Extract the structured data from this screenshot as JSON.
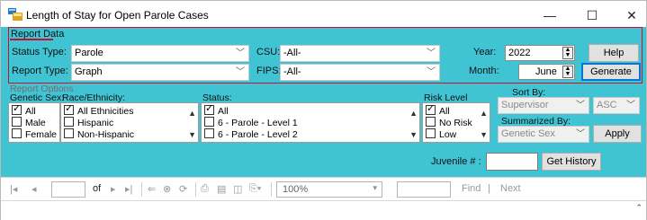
{
  "window": {
    "title": "Length of Stay for Open Parole Cases",
    "min_glyph": "—",
    "max_glyph": "☐",
    "close_glyph": "✕"
  },
  "report_data": {
    "group_label": "Report Data",
    "status_type_label": "Status Type:",
    "status_type_value": "Parole",
    "report_type_label": "Report Type:",
    "report_type_value": "Graph",
    "csu_label": "CSU:",
    "csu_value": "-All-",
    "fips_label": "FIPS:",
    "fips_value": "-All-",
    "year_label": "Year:",
    "year_value": "2022",
    "month_label": "Month:",
    "month_value": "June",
    "help_label": "Help",
    "generate_label": "Generate"
  },
  "report_options": {
    "group_label": "Report Options",
    "genetic_sex_label": "Genetic Sex:",
    "genetic_sex_items": [
      {
        "label": "All",
        "checked": true
      },
      {
        "label": "Male",
        "checked": false
      },
      {
        "label": "Female",
        "checked": false
      }
    ],
    "race_label": "Race/Ethnicity:",
    "race_items": [
      {
        "label": "All Ethnicities",
        "checked": true
      },
      {
        "label": "Hispanic",
        "checked": false
      },
      {
        "label": "Non-Hispanic",
        "checked": false
      }
    ],
    "status_label": "Status:",
    "status_items": [
      {
        "label": "All",
        "checked": true
      },
      {
        "label": "6 - Parole - Level 1",
        "checked": false
      },
      {
        "label": "6 - Parole - Level 2",
        "checked": false
      }
    ],
    "risk_label": "Risk Level",
    "risk_items": [
      {
        "label": "All",
        "checked": true
      },
      {
        "label": "No Risk",
        "checked": false
      },
      {
        "label": "Low",
        "checked": false
      }
    ],
    "sort_by_label": "Sort By:",
    "sort_by_value": "Supervisor",
    "sort_order_value": "ASC",
    "summarized_by_label": "Summarized By:",
    "summarized_by_value": "Genetic Sex",
    "apply_label": "Apply"
  },
  "juvenile": {
    "label": "Juvenile # :",
    "value": "",
    "get_history_label": "Get History"
  },
  "viewer_toolbar": {
    "page_value": "",
    "of_label": "of",
    "zoom_value": "100%",
    "find_value": "",
    "find_label": "Find",
    "separator": "|",
    "next_label": "Next"
  }
}
